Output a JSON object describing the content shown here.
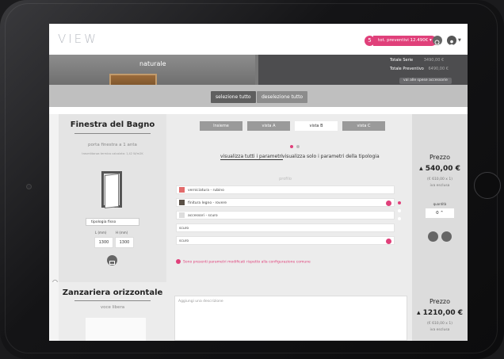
{
  "app": {
    "logo": "VIEW"
  },
  "header": {
    "quote_count": "5",
    "quote_label": "tot. preventivi 12.490€ ▾"
  },
  "banner": {
    "finish_name": "naturale",
    "totals": [
      {
        "label": "Totale Serie",
        "value": "3490,00 €"
      },
      {
        "label": "Totale Preventivo",
        "value": "6490,00 €"
      }
    ],
    "accessories_button": "vai alle spese accessorie"
  },
  "selection": {
    "select_all": "selezione tutto",
    "deselect_all": "deselezione tutto"
  },
  "product1": {
    "title": "Finestra del Bagno",
    "subtitle": "porta finestra a 1 anta",
    "note": "trasmittanza termica calcolata: 1,42 W/m2K",
    "typology": "tipologia fisso",
    "width_label": "L (mm)",
    "height_label": "H (mm)",
    "width": "1300",
    "height": "1300",
    "tabs": [
      "Insieme",
      "vista A",
      "vista B",
      "vista C"
    ],
    "active_tab": 2,
    "view_all": "visualizza tutti i parametri",
    "view_typology": "visualizza solo i parametri della tipologia",
    "profile_label": "profilo",
    "params": [
      {
        "label": "verniciatura - rubino",
        "color": "#e26b6b",
        "warn": false
      },
      {
        "label": "finitura legno - rovere",
        "color": "#5a5046",
        "warn": true
      },
      {
        "label": "accessori - scuro",
        "color": "#cccccc",
        "warn": false
      },
      {
        "label": "scuro",
        "color": "",
        "warn": false
      },
      {
        "label": "scuro",
        "color": "",
        "warn": true
      }
    ],
    "warning_message": "Sono presenti parametri modificati rispetto alla configurazione comune",
    "price_label": "Prezzo",
    "price": "▴ 540,00 €",
    "price_detail": "(€ 610,00 x 1)",
    "vat_note": "iva esclusa",
    "quantity_label": "quantità",
    "quantity": "0 ⌃"
  },
  "product2": {
    "title": "Zanzariera orizzontale",
    "subtitle": "voce libera",
    "description_placeholder": "Aggiungi una descrizione",
    "price_label": "Prezzo",
    "price": "▴ 1210,00 €",
    "price_detail": "(€ 610,00 x 1)",
    "vat_note": "iva esclusa"
  },
  "colors": {
    "accent": "#e0407a",
    "dark_gray": "#4d4d4f"
  }
}
